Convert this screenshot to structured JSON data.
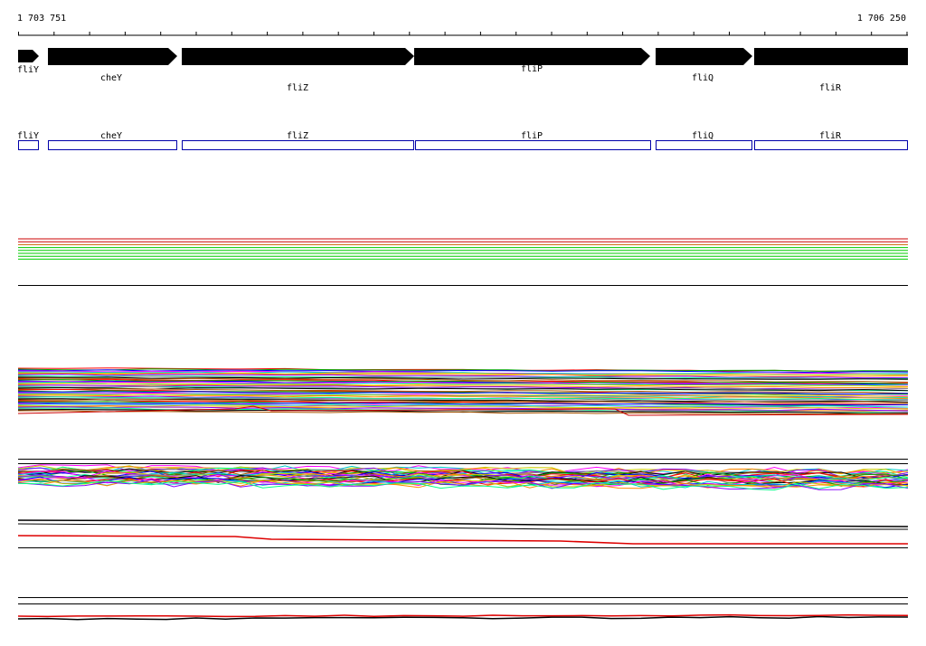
{
  "ruler": {
    "start_label": "1 703 751",
    "end_label": "1 706 250"
  },
  "colors": {
    "gene_arrow": "#000000",
    "gene_box_stroke": "#0000aa",
    "track_palette": [
      "#ff0000",
      "#00aa00",
      "#0000ff",
      "#ff00ff",
      "#00cccc",
      "#cccc00",
      "#ff8800",
      "#8800ff",
      "#00ff88",
      "#888888",
      "#000000",
      "#aa5500"
    ]
  },
  "genes": [
    {
      "name": "fliY",
      "strand": "+"
    },
    {
      "name": "cheY",
      "strand": "+"
    },
    {
      "name": "fliZ",
      "strand": "+"
    },
    {
      "name": "fliP",
      "strand": "+"
    },
    {
      "name": "fliQ",
      "strand": "+"
    },
    {
      "name": "fliR",
      "strand": "+"
    }
  ],
  "boxes": [
    {
      "name": "fliY"
    },
    {
      "name": "cheY"
    },
    {
      "name": "fliZ"
    },
    {
      "name": "fliP"
    },
    {
      "name": "fliQ"
    },
    {
      "name": "fliR"
    }
  ]
}
